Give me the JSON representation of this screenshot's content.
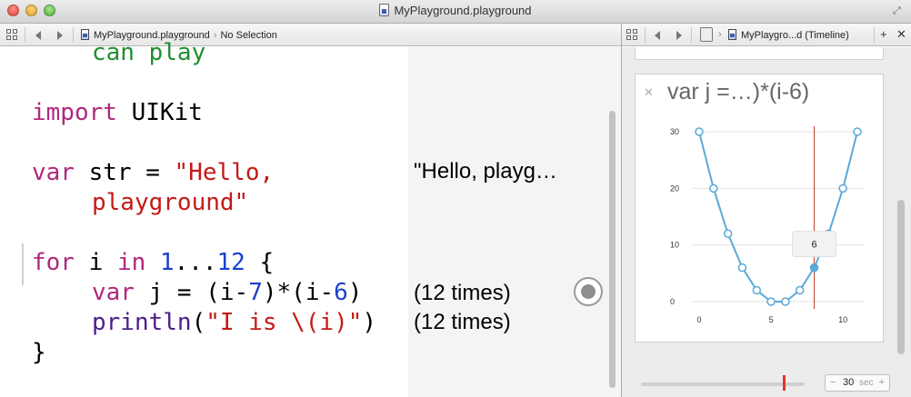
{
  "window": {
    "title": "MyPlayground.playground"
  },
  "editor_jumpbar": {
    "file": "MyPlayground.playground",
    "selection": "No Selection"
  },
  "assistant_jumpbar": {
    "file": "MyPlaygro...d (Timeline)"
  },
  "code_lines": {
    "line1": "can play",
    "line2_kw": "import",
    "line2_rest": " UIKit",
    "line3_kw": "var",
    "line3_mid": " str = ",
    "line3_str": "\"Hello,",
    "line4_str": "playground\"",
    "line5_kw1": "for",
    "line5_i": " i ",
    "line5_kw2": "in",
    "line5_num1": "1",
    "line5_range": "...",
    "line5_num2": "12",
    "line5_brace": " {",
    "line6_kw": "var",
    "line6_mid1": " j = (i-",
    "line6_num1": "7",
    "line6_mid2": ")*(i-",
    "line6_num2": "6",
    "line6_end": ")",
    "line7_fn": "println",
    "line7_open": "(",
    "line7_str": "\"I is \\(i)\"",
    "line7_close": ")",
    "line8": "}"
  },
  "results": {
    "str_result": "\"Hello, playg…",
    "loop_j": "(12 times)",
    "loop_println": "(12 times)"
  },
  "timeline": {
    "card_title": "var j =…)*(i-6)",
    "tooltip_value": "6",
    "duration_value": "30",
    "duration_unit": "sec",
    "minus": "−",
    "plus": "+"
  },
  "chart_data": {
    "type": "line",
    "title": "var j =…)*(i-6)",
    "x": [
      0,
      1,
      2,
      3,
      4,
      5,
      6,
      7,
      8,
      9,
      10,
      11
    ],
    "values": [
      30,
      20,
      12,
      6,
      2,
      0,
      0,
      2,
      6,
      12,
      20,
      30
    ],
    "x_ticks": [
      "0",
      "5",
      "10"
    ],
    "y_ticks": [
      "0",
      "10",
      "20",
      "30"
    ],
    "xlim": [
      0,
      11
    ],
    "ylim": [
      0,
      30
    ],
    "grid": true,
    "highlight": {
      "x": 8,
      "y": 6,
      "label": "6"
    },
    "colors": {
      "line": "#5aa9d8",
      "marker_fill": "#ffffff",
      "cursor": "#c0392b"
    }
  },
  "colors": {
    "keyword": "#b0277c",
    "string": "#c41a16",
    "number": "#1c3fd0",
    "comment": "#1f8f30",
    "function": "#4b1e8a"
  }
}
